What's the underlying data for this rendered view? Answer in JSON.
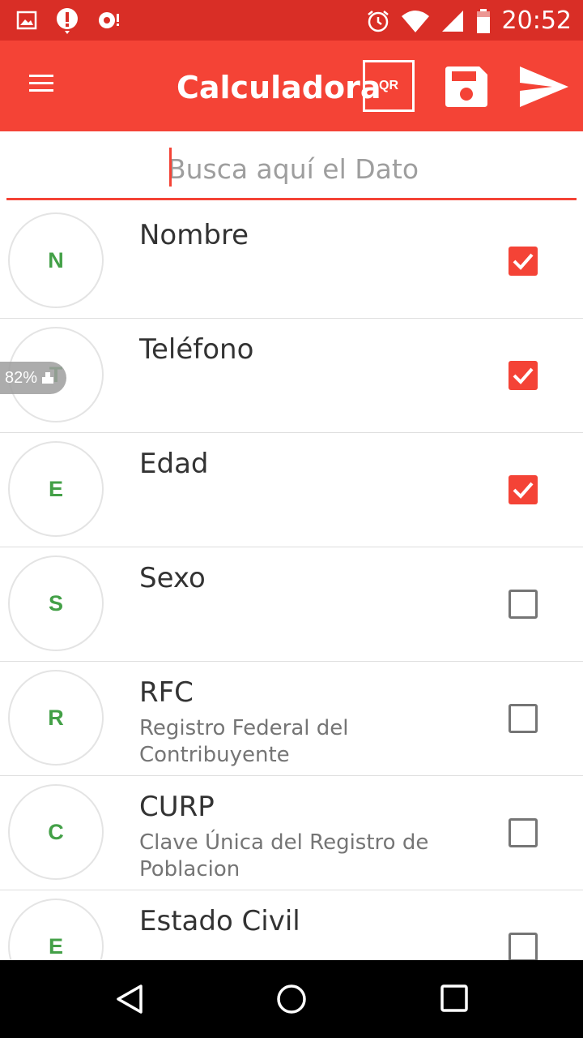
{
  "status_bar": {
    "time": "20:52",
    "icons_left": [
      "image-icon",
      "alert-icon",
      "sync-icon"
    ],
    "icons_right": [
      "alarm-icon",
      "wifi-icon",
      "signal-icon",
      "battery-icon"
    ]
  },
  "app_bar": {
    "title": "Calculadora",
    "qr_label": "QR",
    "color": "#f44336"
  },
  "search": {
    "placeholder": "Busca aquí el Dato",
    "value": ""
  },
  "items": [
    {
      "initial": "N",
      "title": "Nombre",
      "subtitle": "",
      "checked": true
    },
    {
      "initial": "T",
      "title": "Teléfono",
      "subtitle": "",
      "checked": true
    },
    {
      "initial": "E",
      "title": "Edad",
      "subtitle": "",
      "checked": true
    },
    {
      "initial": "S",
      "title": "Sexo",
      "subtitle": "",
      "checked": false
    },
    {
      "initial": "R",
      "title": "RFC",
      "subtitle": "Registro Federal del Contribuyente",
      "checked": false
    },
    {
      "initial": "C",
      "title": "CURP",
      "subtitle": "Clave Única del Registro de Poblacion",
      "checked": false
    },
    {
      "initial": "E",
      "title": "Estado Civil",
      "subtitle": "",
      "checked": false
    }
  ],
  "overlay": {
    "battery_percent": "82%"
  },
  "nav_bar": {
    "buttons": [
      "back-icon",
      "home-icon",
      "recents-icon"
    ]
  }
}
